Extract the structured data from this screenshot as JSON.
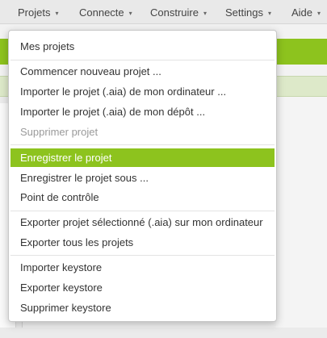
{
  "top_menu": {
    "projets": "Projets",
    "connecte": "Connecte",
    "construire": "Construire",
    "settings": "Settings",
    "aide": "Aide",
    "caret": "▾"
  },
  "dropdown": {
    "mes_projets": "Mes projets",
    "commencer": "Commencer nouveau projet ...",
    "importer_ordinateur": "Importer le projet (.aia) de mon ordinateur ...",
    "importer_depot": "Importer le projet (.aia) de mon dépôt ...",
    "supprimer_projet": "Supprimer projet",
    "enregistrer": "Enregistrer le projet",
    "enregistrer_sous": "Enregistrer le projet sous ...",
    "point_controle": "Point de contrôle",
    "exporter_selectionne": "Exporter projet sélectionné (.aia) sur mon ordinateur",
    "exporter_tous": "Exporter tous les projets",
    "importer_keystore": "Importer keystore",
    "exporter_keystore": "Exporter keystore",
    "supprimer_keystore": "Supprimer keystore"
  },
  "colors": {
    "accent": "#8dc31e",
    "disabled_text": "#9a9a9a"
  }
}
